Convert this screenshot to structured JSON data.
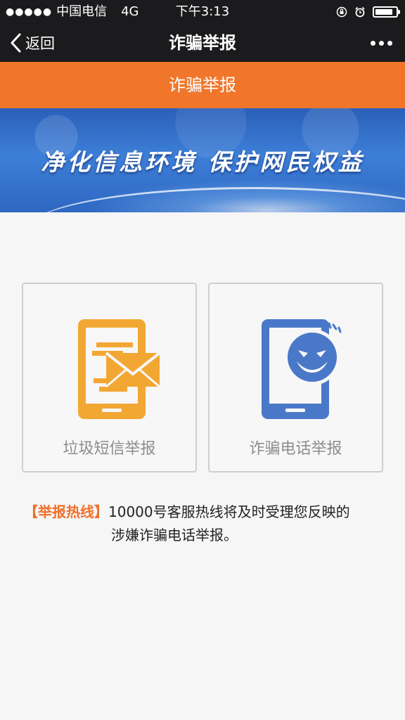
{
  "status_bar": {
    "signal": "●●●●●",
    "carrier": "中国电信",
    "network": "4G",
    "time": "下午3:13"
  },
  "nav": {
    "back_label": "返回",
    "title": "诈骗举报"
  },
  "header": {
    "title": "诈骗举报"
  },
  "banner": {
    "slogan": "净化信息环境  保护网民权益"
  },
  "cards": [
    {
      "label": "垃圾短信举报",
      "icon": "phone-envelope-icon",
      "color": "#f3a733"
    },
    {
      "label": "诈骗电话举报",
      "icon": "phone-scam-face-icon",
      "color": "#4a78c9"
    }
  ],
  "hotline": {
    "tag": "【举报热线】",
    "line1": "10000号客服热线将及时受理您反映的",
    "line2": "涉嫌诈骗电话举报。"
  },
  "colors": {
    "status_bg": "#1b1b1d",
    "accent_orange": "#f2762a",
    "banner_blue": "#3d7fd8"
  }
}
